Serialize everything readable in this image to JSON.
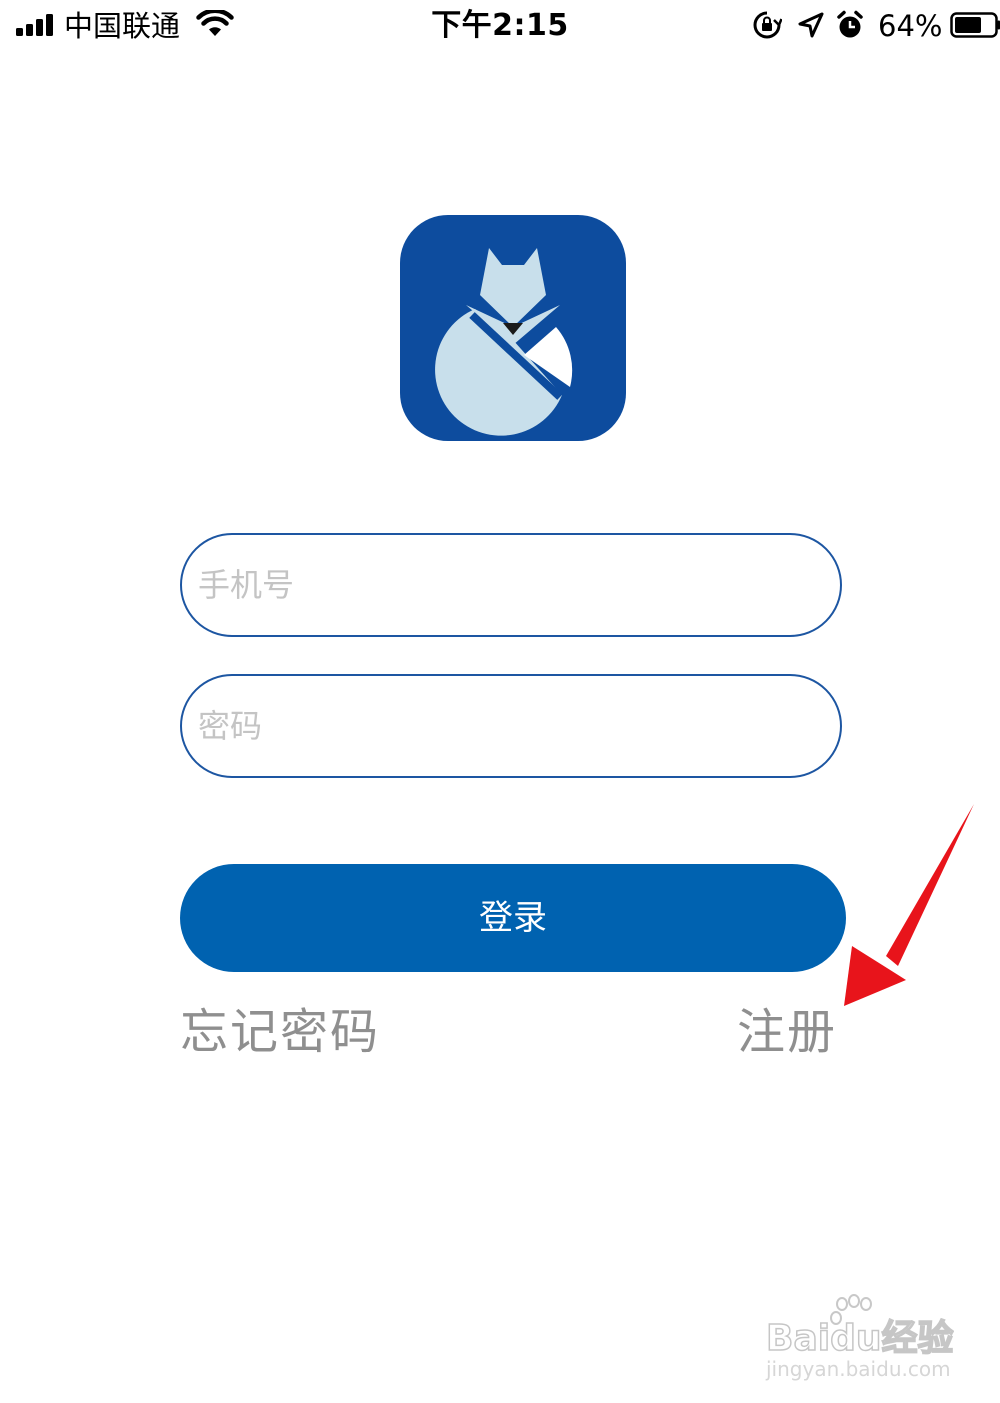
{
  "status_bar": {
    "carrier": "中国联通",
    "time": "下午2:15",
    "battery": "64%",
    "battery_level": 0.64,
    "icons": [
      "signal-icon",
      "wifi-icon",
      "rotation-lock-icon",
      "location-icon",
      "alarm-icon",
      "battery-icon"
    ]
  },
  "logo": {
    "icon": "fox-logo-icon",
    "background_color": "#0d4c9e"
  },
  "form": {
    "phone_placeholder": "手机号",
    "phone_value": "",
    "password_placeholder": "密码",
    "password_value": "",
    "login_label": "登录",
    "login_color": "#0062b0"
  },
  "links": {
    "forgot_password": "忘记密码",
    "register": "注册"
  },
  "annotation": {
    "icon": "red-arrow-icon",
    "color": "#e8141b"
  },
  "watermark": {
    "brand": "Baidu经验",
    "url": "jingyan.baidu.com"
  }
}
